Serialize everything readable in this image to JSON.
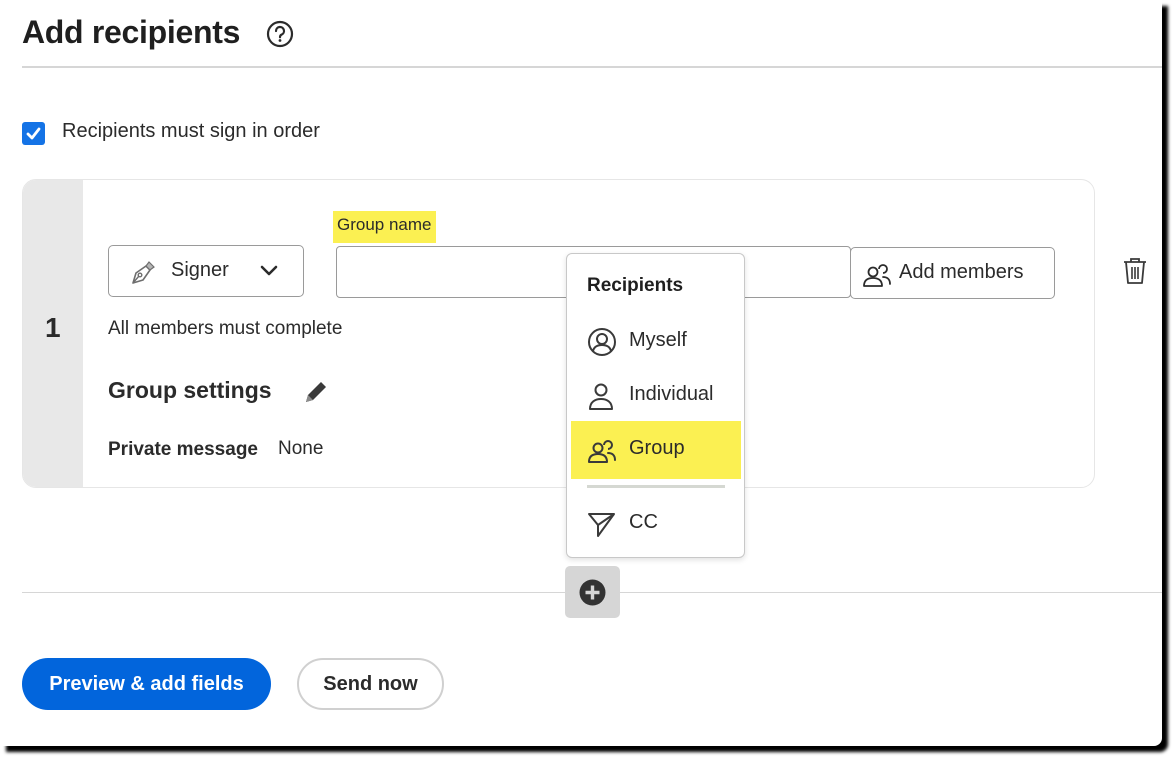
{
  "header": {
    "title": "Add recipients",
    "help_icon": "question-circle-icon"
  },
  "sign_order": {
    "checked": true,
    "label": "Recipients must sign in order",
    "accent_color": "#1473e6"
  },
  "recipient": {
    "order_number": "1",
    "role": {
      "icon": "pen-nib-icon",
      "label": "Signer",
      "chevron": "chevron-down-icon"
    },
    "group_name": {
      "label": "Group name",
      "value": "",
      "placeholder": ""
    },
    "add_members": {
      "icon": "group-icon",
      "label": "Add members"
    },
    "completion_rule": "All members must complete",
    "group_settings": {
      "title": "Group settings",
      "edit_icon": "pencil-icon"
    },
    "private_message": {
      "label": "Private message",
      "value": "None"
    },
    "delete_icon": "trash-icon"
  },
  "recipients_menu": {
    "heading": "Recipients",
    "items": [
      {
        "label": "Myself",
        "icon": "user-circle-icon",
        "highlighted": false
      },
      {
        "label": "Individual",
        "icon": "user-icon",
        "highlighted": false
      },
      {
        "label": "Group",
        "icon": "group-icon",
        "highlighted": true
      },
      {
        "label": "CC",
        "icon": "send-icon",
        "highlighted": false
      }
    ],
    "highlight_color": "#fbf052"
  },
  "add_recipient": {
    "icon": "plus-circle-icon"
  },
  "footer": {
    "primary_label": "Preview & add fields",
    "secondary_label": "Send now",
    "primary_color": "#0265dc"
  }
}
